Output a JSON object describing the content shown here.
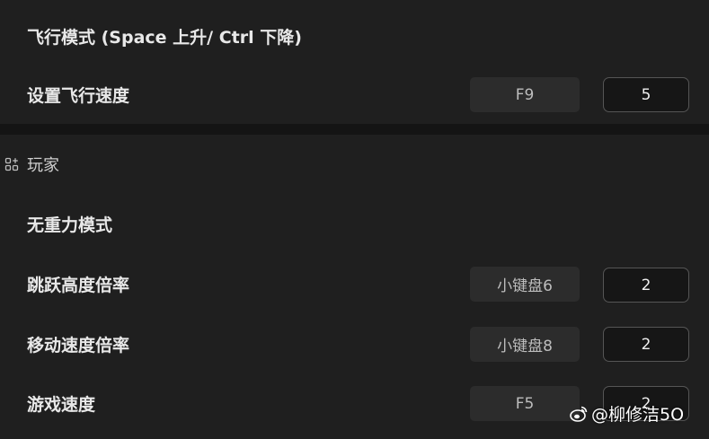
{
  "flight": {
    "mode_label": "飞行模式 (Space 上升/ Ctrl 下降)",
    "speed_label": "设置飞行速度",
    "speed_key": "F9",
    "speed_value": "5"
  },
  "player": {
    "section_title": "玩家",
    "section_icon": "grid-plus-icon",
    "rows": [
      {
        "label": "无重力模式"
      },
      {
        "label": "跳跃高度倍率",
        "key": "小键盘6",
        "value": "2"
      },
      {
        "label": "移动速度倍率",
        "key": "小键盘8",
        "value": "2"
      },
      {
        "label": "游戏速度",
        "key": "F5",
        "value": "2"
      }
    ]
  },
  "watermark": {
    "text": "@柳修洁5O",
    "icon": "weibo-icon"
  },
  "colors": {
    "panel": "#1f1f1f",
    "divider": "#141414",
    "key_button": "#2c2c2c",
    "field_border": "#555555"
  }
}
